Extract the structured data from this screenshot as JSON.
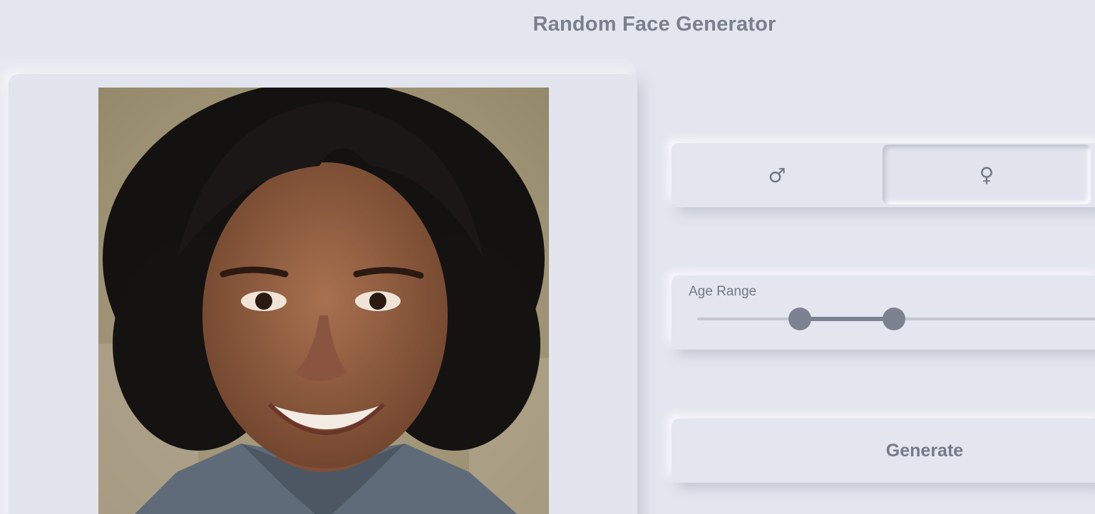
{
  "header": {
    "title": "Random Face Generator"
  },
  "portrait": {
    "alt": "Generated face of a smiling young woman with curly dark hair"
  },
  "gender": {
    "options": [
      {
        "label": "♂",
        "icon": "male-icon",
        "selected": false
      },
      {
        "label": "♀",
        "icon": "female-icon",
        "selected": true
      }
    ]
  },
  "age": {
    "label": "Age Range",
    "range_low_fraction": 0.24,
    "range_high_fraction": 0.46
  },
  "actions": {
    "generate_label": "Generate"
  },
  "colors": {
    "background": "#e3e6ee",
    "text": "#7a808d",
    "slider_active": "#7b818f",
    "slider_track": "#c3c7d1"
  }
}
